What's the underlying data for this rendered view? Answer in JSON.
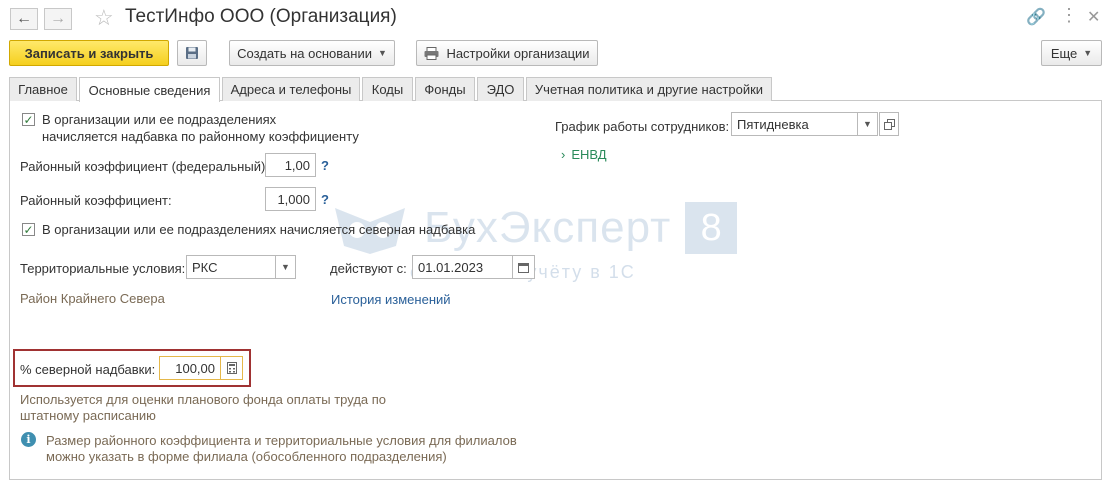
{
  "window": {
    "title": "ТестИнфо ООО (Организация)"
  },
  "toolbar": {
    "save_close": "Записать и закрыть",
    "create_based": "Создать на основании",
    "org_settings": "Настройки организации",
    "more": "Еще"
  },
  "tabs": [
    {
      "label": "Главное"
    },
    {
      "label": "Основные сведения"
    },
    {
      "label": "Адреса и телефоны"
    },
    {
      "label": "Коды"
    },
    {
      "label": "Фонды"
    },
    {
      "label": "ЭДО"
    },
    {
      "label": "Учетная политика и другие настройки"
    }
  ],
  "form": {
    "district_coef_check_label_1": "В организации или ее подразделениях",
    "district_coef_check_label_2": "начисляется надбавка по районному коэффициенту",
    "fed_coef_label": "Районный коэффициент (федеральный):",
    "fed_coef_value": "1,00",
    "coef_label": "Районный коэффициент:",
    "coef_value": "1,000",
    "help_mark": "?",
    "north_check_label": "В организации или ее подразделениях начисляется северная надбавка",
    "terr_label": "Территориальные условия:",
    "terr_value": "РКС",
    "valid_from_label": "действуют с:",
    "valid_from_value": "01.01.2023",
    "region_text": "Район Крайнего Севера",
    "history_link": "История изменений",
    "north_pct_label": "% северной надбавки:",
    "north_pct_value": "100,00",
    "usage_note_1": "Используется для оценки планового фонда оплаты труда по",
    "usage_note_2": "штатному расписанию",
    "info_1": "Размер районного коэффициента и территориальные условия для филиалов",
    "info_2": "можно указать в форме филиала (обособленного подразделения)",
    "schedule_label": "График работы сотрудников:",
    "schedule_value": "Пятидневка",
    "envd_label": "ЕНВД"
  },
  "watermark": {
    "brand": "БухЭксперт",
    "digit": "8",
    "tagline": "советов по учёту в 1С"
  }
}
